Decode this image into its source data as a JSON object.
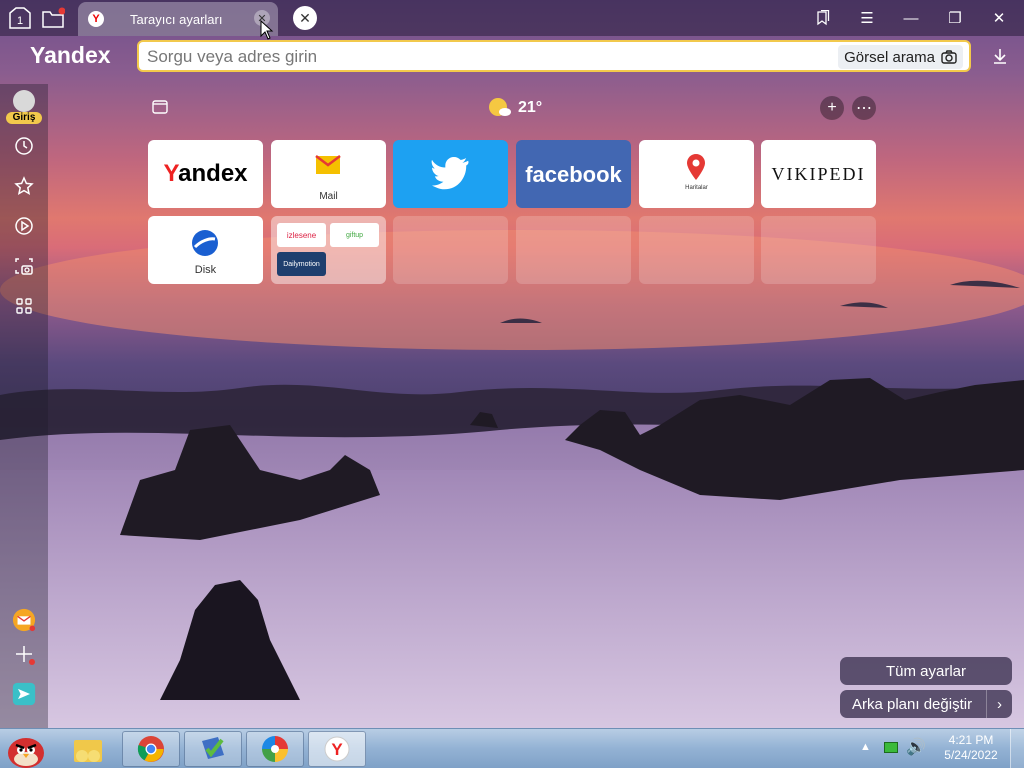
{
  "browser": {
    "tab_title": "Tarayıcı ayarları",
    "logo": "Yandex"
  },
  "omnibox": {
    "placeholder": "Sorgu veya adres girin",
    "image_search_label": "Görsel arama"
  },
  "sidebar": {
    "login_label": "Giriş"
  },
  "weather": {
    "temperature": "21°"
  },
  "tiles": [
    {
      "name": "Yandex",
      "caption": ""
    },
    {
      "name": "Mail",
      "caption": "Mail"
    },
    {
      "name": "twitter",
      "caption": ""
    },
    {
      "name": "facebook",
      "caption": "facebook"
    },
    {
      "name": "Haritalar",
      "caption": "Haritalar"
    },
    {
      "name": "Vikipedi",
      "caption": "VIKIPEDI"
    },
    {
      "name": "Disk",
      "caption": "Disk"
    },
    {
      "name": "folder",
      "caption": "",
      "sub": [
        "izlesene",
        "giftup",
        "Dailymotion"
      ]
    }
  ],
  "bottom": {
    "all_settings": "Tüm ayarlar",
    "change_background": "Arka planı değiştir"
  },
  "taskbar": {
    "time": "4:21 PM",
    "date": "5/24/2022",
    "tab_counter": "1"
  },
  "colors": {
    "twitter_tile": "#1da1f2",
    "facebook_tile": "#4267b2",
    "omnibox_border": "#f2c94c"
  }
}
